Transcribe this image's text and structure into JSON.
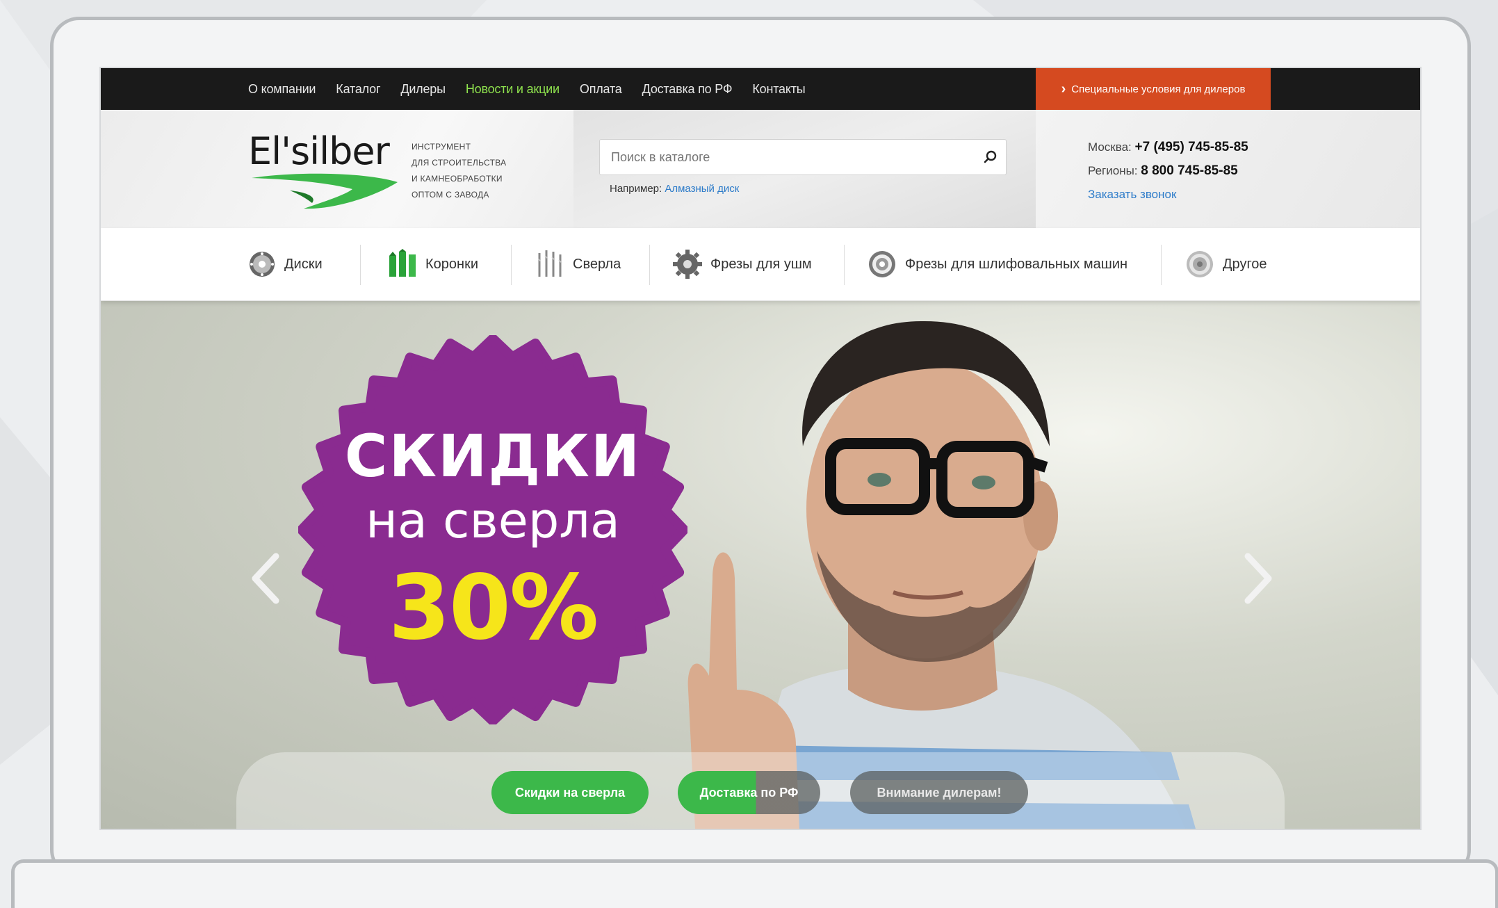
{
  "topnav": {
    "links": [
      {
        "label": "О компании"
      },
      {
        "label": "Каталог"
      },
      {
        "label": "Дилеры"
      },
      {
        "label": "Новости и акции",
        "active": true
      },
      {
        "label": "Оплата"
      },
      {
        "label": "Доставка по РФ"
      },
      {
        "label": "Контакты"
      }
    ],
    "dealer_button": "Специальные условия для дилеров"
  },
  "header": {
    "logo": "El'silber",
    "tagline": [
      "ИНСТРУМЕНТ",
      "ДЛЯ СТРОИТЕЛЬСТВА",
      "И КАМНЕОБРАБОТКИ",
      "ОПТОМ С ЗАВОДА"
    ],
    "search": {
      "placeholder": "Поиск в каталоге",
      "example_label": "Например:",
      "example_link": "Алмазный диск"
    },
    "contacts": {
      "moscow_label": "Москва:",
      "moscow_phone": "+7 (495) 745-85-85",
      "regions_label": "Регионы:",
      "regions_phone": "8 800 745-85-85",
      "callback": "Заказать звонок"
    }
  },
  "categories": [
    {
      "label": "Диски",
      "icon": "disc-icon"
    },
    {
      "label": "Коронки",
      "icon": "crown-bit-icon"
    },
    {
      "label": "Сверла",
      "icon": "drill-bits-icon"
    },
    {
      "label": "Фрезы для ушм",
      "icon": "gear-cutter-icon"
    },
    {
      "label": "Фрезы для шлифовальных машин",
      "icon": "grinding-cutter-icon"
    },
    {
      "label": "Другое",
      "icon": "other-disc-icon"
    }
  ],
  "hero": {
    "badge_line1": "СКИДКИ",
    "badge_line2": "на сверла",
    "badge_line3": "30%",
    "badge_color": "#8a2b90",
    "highlight_color": "#f6e51a",
    "tabs": [
      {
        "label": "Скидки на сверла",
        "state": "active"
      },
      {
        "label": "Доставка по РФ",
        "state": "active"
      },
      {
        "label": "Внимание дилерам!",
        "state": "inactive"
      }
    ]
  },
  "colors": {
    "accent_green": "#3cb84a",
    "nav_active": "#8fe34e",
    "dealer_orange": "#d54a20",
    "link_blue": "#2c7bc9"
  }
}
